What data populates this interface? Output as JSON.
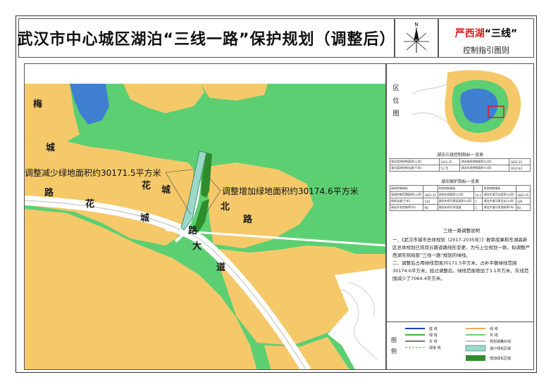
{
  "title": "武汉市中心城区湖泊“三线一路”保护规划（调整后）",
  "header": {
    "lake_name": "严西湖",
    "lake_suffix": "“三线”",
    "subtitle": "控制指引图则",
    "compass_letter": "N"
  },
  "map": {
    "road_labels": [
      "梅",
      "城",
      "路",
      "花",
      "城",
      "花",
      "城",
      "北",
      "路",
      "路",
      "大",
      "道"
    ],
    "annotation_decrease": "调整减少绿地面积约30171.5平方米",
    "annotation_increase": "调整增加绿地面积约30174.6平方米"
  },
  "colors": {
    "land_yellow": "#f5c96a",
    "green_space": "#5ccf72",
    "water": "#3f7fd0",
    "road": "#ffffff",
    "added_green": "#2e8c2b",
    "reduced_green": "#9ad9c8"
  },
  "location": {
    "label": "区位图"
  },
  "table1": {
    "title": "湖泊三线控制指标一览表",
    "rows": [
      [
        "湖泊蓝线控制面积(公顷)",
        "1423.37",
        "湖泊绿线控制面积(公顷)",
        "1822.35"
      ],
      [
        "湖泊蓝线控制长度(千米)",
        "72.75",
        "湖泊灰线控制面积(公顷)",
        "1610.63"
      ]
    ]
  },
  "table2": {
    "title": "湖泊保护指标一览表",
    "rows": [
      [
        "绿线控制指标",
        "",
        "灰线控制指标",
        "",
        "其他控制指标",
        ""
      ],
      [
        "绿线控制范围面积(公顷)",
        "1822.35",
        "湖泊灰线面积(公顷)",
        "14.1",
        "湖泊步道可达面积(公顷)",
        "1822.35"
      ],
      [
        "绿线长度(千米)",
        "120",
        "湖泊灰线可建设面积(公顷)",
        "1",
        "湖泊步道可建设长(公顷)",
        "120"
      ],
      [
        "绿化开发控制率(%)",
        "90",
        "湖泊灰线开发强度",
        "1",
        "湖泊步道开发控制率(%)",
        "90"
      ]
    ]
  },
  "notes": {
    "title": "三线一路调整说明",
    "items": [
      "一、《武汉市城市总体规划（2017-2035年）》报审成果和东湖高新区总体规划已将双谷路道路线形变更，为与上位规划一致，拟调整严西湖东侧局部“三线一路”规划的绿线。",
      "二、调整后占用绿线范围30171.5平方米，占补平衡绿线范围30174.6平方米，经过调整后，绿线范围增加了3.1平方米，灰线范围减少了7064.4平方米。"
    ]
  },
  "legend": {
    "label": "图例",
    "items": [
      "蓝    线",
      "绿    线",
      "灰    线",
      "绿道    线",
      "绿    线",
      "灰    线",
      "规划道路红线",
      "减少绿化区域",
      "增加绿化区域"
    ]
  }
}
